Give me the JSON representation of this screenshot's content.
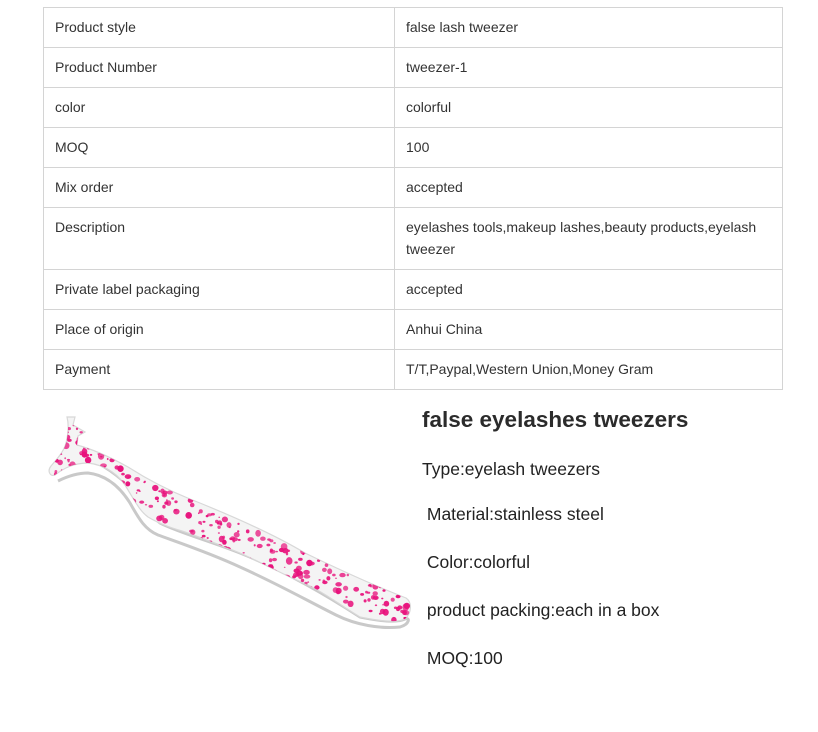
{
  "spec_table": {
    "rows": [
      {
        "label": "Product style",
        "value": "false lash tweezer"
      },
      {
        "label": "Product Number",
        "value": "tweezer-1"
      },
      {
        "label": "color",
        "value": "colorful"
      },
      {
        "label": "MOQ",
        "value": "100"
      },
      {
        "label": "Mix order",
        "value": "accepted"
      },
      {
        "label": "Description",
        "value": "eyelashes tools,makeup lashes,beauty products,eyelash tweezer"
      },
      {
        "label": "Private label packaging",
        "value": "accepted"
      },
      {
        "label": "Place of origin",
        "value": "Anhui  China"
      },
      {
        "label": "Payment",
        "value": "T/T,Paypal,Western Union,Money Gram"
      }
    ]
  },
  "product": {
    "image_icon": "pink-speckled-lash-tweezer-image",
    "speckle_color": "#e8127c",
    "body_color": "#f4f4f4",
    "title": "false eyelashes tweezers",
    "type_line": "Type:eyelash tweezers",
    "material_line": " Material:stainless steel",
    "color_line": " Color:colorful",
    "packing_line": " product packing:each in a box",
    "moq_line": " MOQ:100"
  }
}
